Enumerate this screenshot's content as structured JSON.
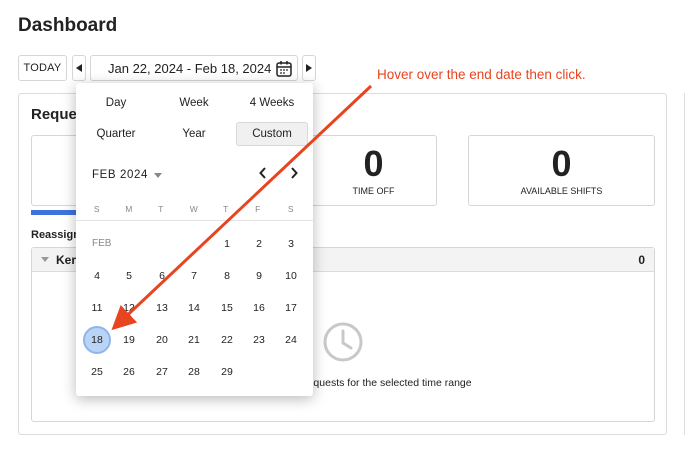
{
  "page_title": "Dashboard",
  "toolbar": {
    "today_label": "TODAY",
    "prev_icon": "caret-left-icon",
    "next_icon": "caret-right-icon",
    "date_range": "Jan 22, 2024 - Feb 18, 2024",
    "calendar_icon": "calendar-icon"
  },
  "requests": {
    "title": "Reque",
    "stats": [
      {
        "value": "0",
        "label": "TIME OFF"
      },
      {
        "value": "0",
        "label": "AVAILABLE SHIFTS"
      }
    ],
    "reassign_label": "Reassign",
    "group": {
      "name": "Ker",
      "count": "0"
    },
    "empty_icon": "clock-icon",
    "empty_message": "nment requests for the selected time range"
  },
  "datepicker": {
    "presets": [
      "Day",
      "Week",
      "4 Weeks",
      "Quarter",
      "Year",
      "Custom"
    ],
    "selected_preset": "Custom",
    "month_label": "FEB 2024",
    "weekdays": [
      "S",
      "M",
      "T",
      "W",
      "T",
      "F",
      "S"
    ],
    "month_row_label": "FEB",
    "weeks": [
      [
        "",
        "",
        "",
        "",
        "1",
        "2",
        "3"
      ],
      [
        "4",
        "5",
        "6",
        "7",
        "8",
        "9",
        "10"
      ],
      [
        "11",
        "12",
        "13",
        "14",
        "15",
        "16",
        "17"
      ],
      [
        "18",
        "19",
        "20",
        "21",
        "22",
        "23",
        "24"
      ],
      [
        "25",
        "26",
        "27",
        "28",
        "29",
        "",
        ""
      ]
    ],
    "selected_day": "18"
  },
  "annotation": {
    "text": "Hover over the end date then click.",
    "color": "#e8441f"
  }
}
